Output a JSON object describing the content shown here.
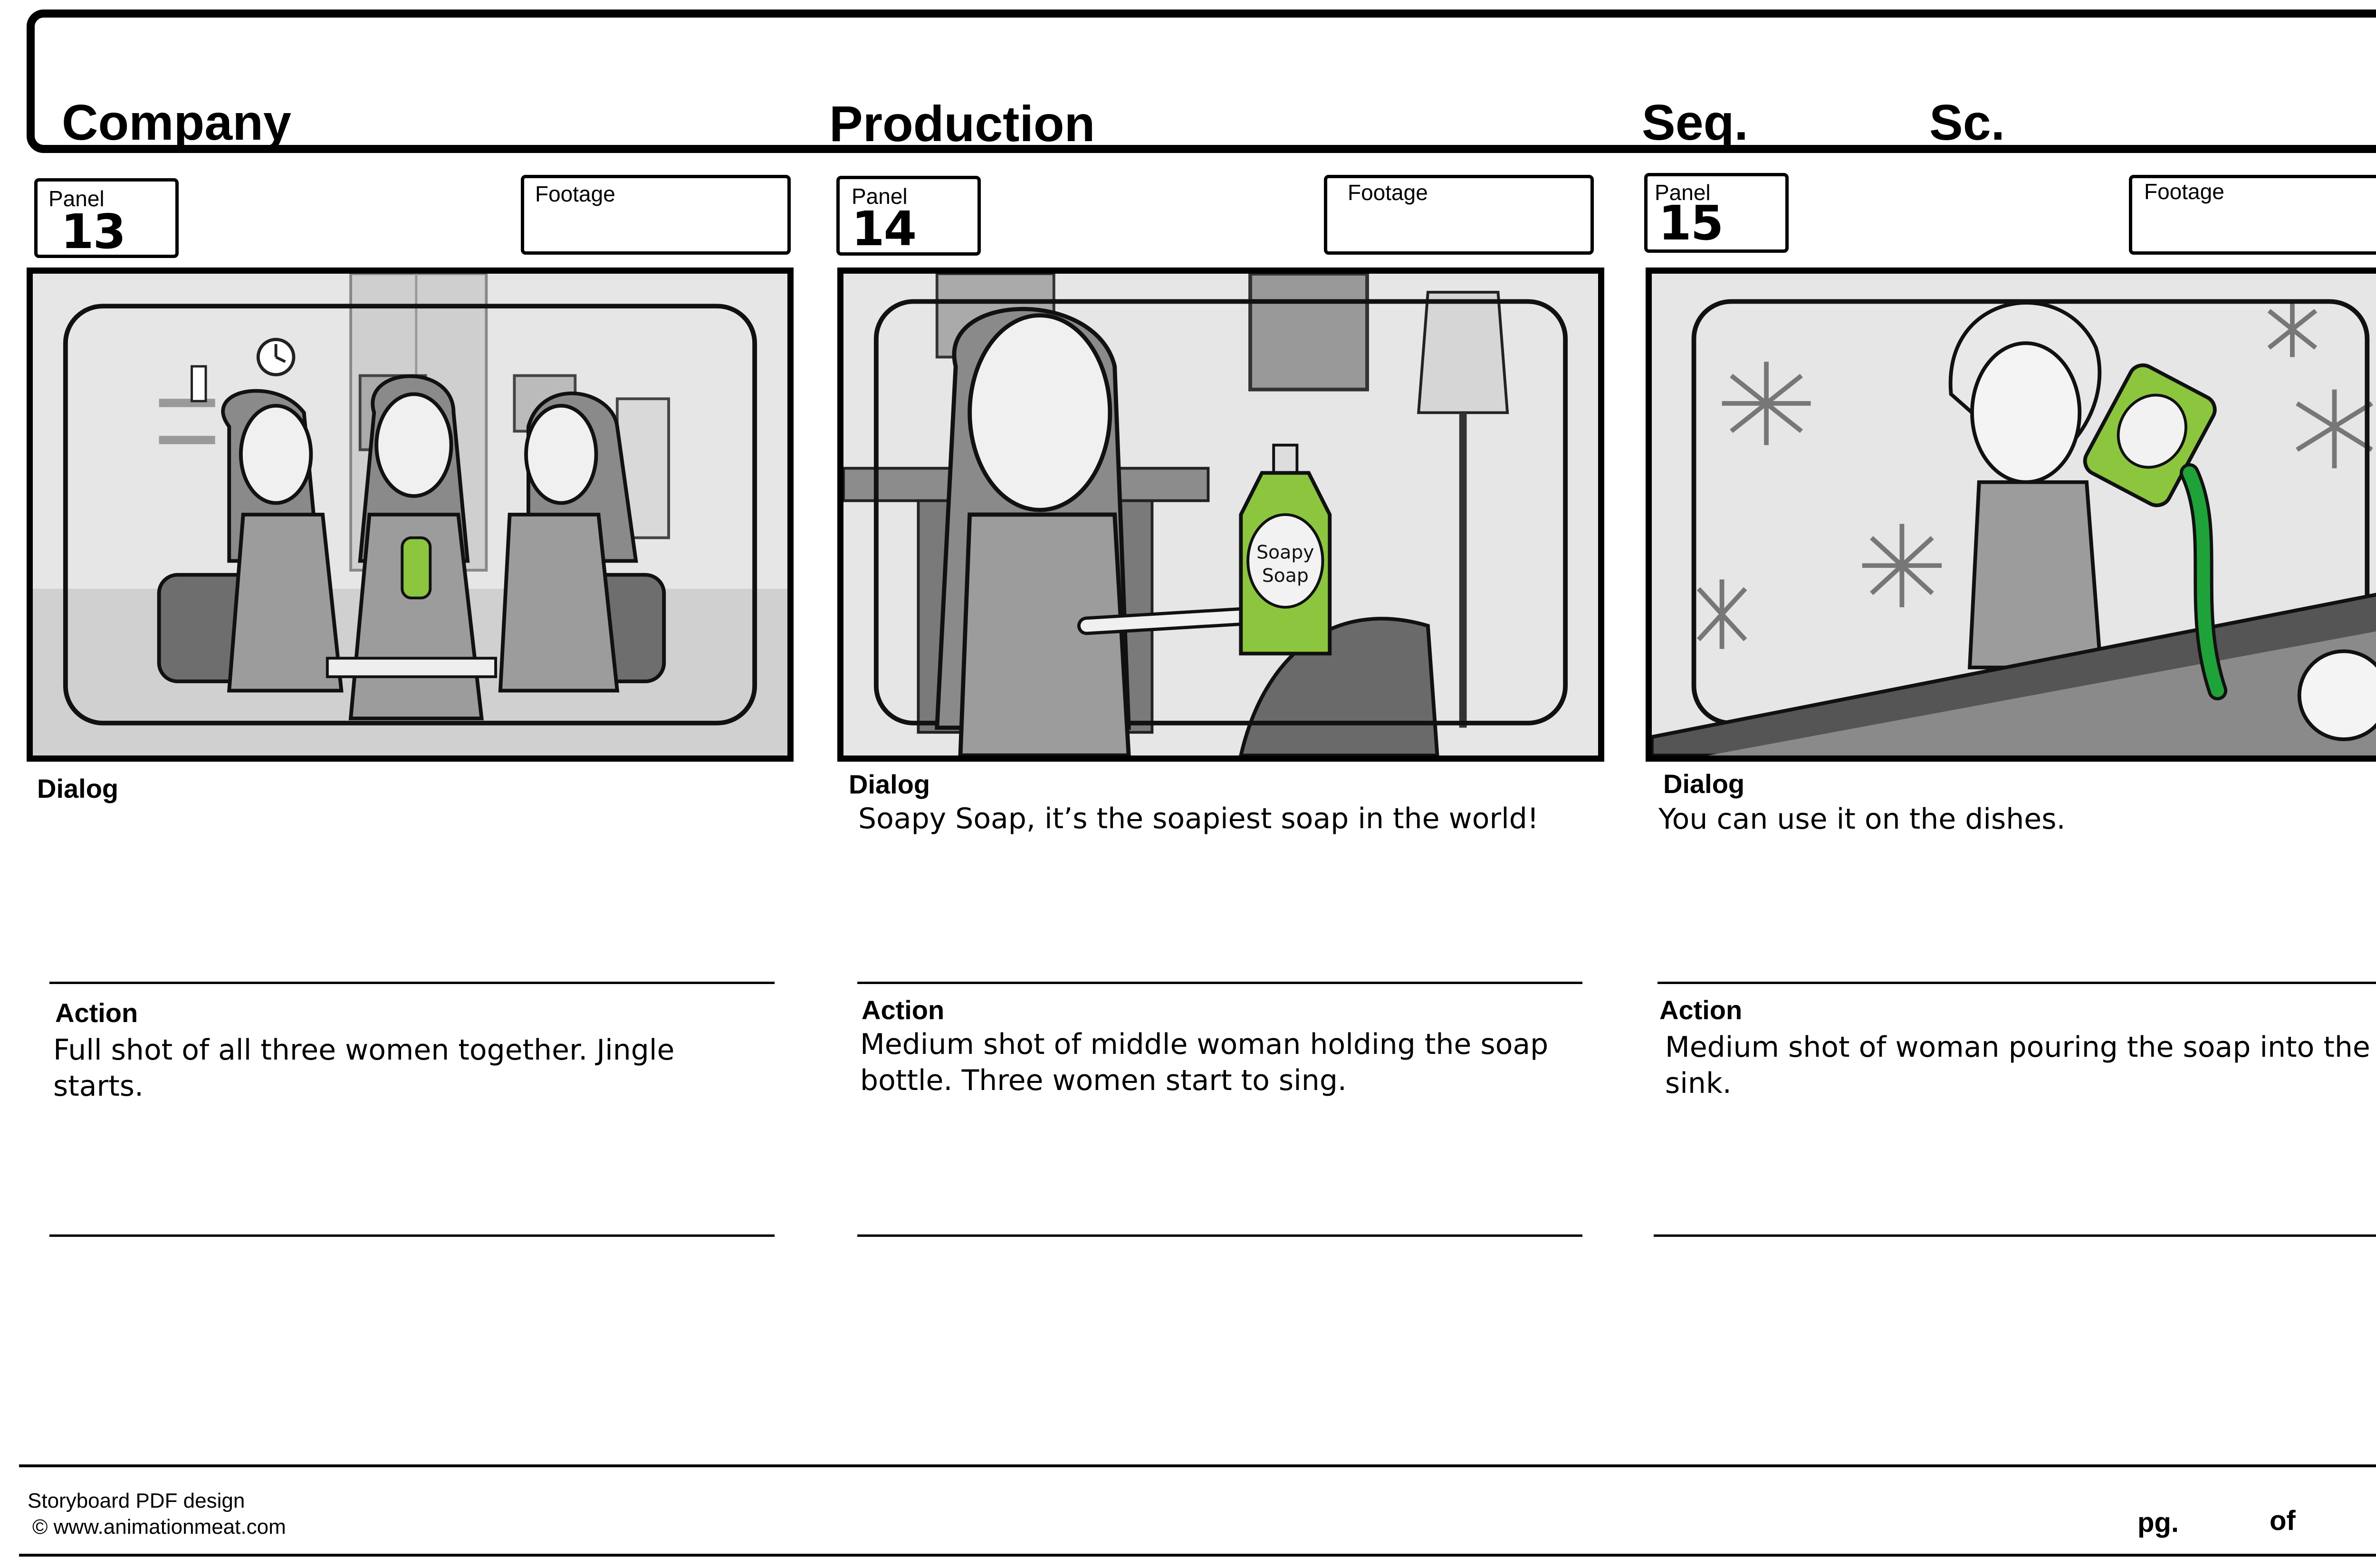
{
  "header": {
    "company_label": "Company",
    "production_label": "Production",
    "sequence_label": "Seq.",
    "scene_label": "Sc."
  },
  "panels": [
    {
      "panel_label": "Panel",
      "panel_number": "13",
      "footage_label": "Footage",
      "dialog_label": "Dialog",
      "dialog_text": "",
      "action_label": "Action",
      "action_text": "Full shot of all three women together. Jingle\nstarts."
    },
    {
      "panel_label": "Panel",
      "panel_number": "14",
      "footage_label": "Footage",
      "dialog_label": "Dialog",
      "dialog_text": "Soapy Soap, it’s the soapiest soap in the world!",
      "action_label": "Action",
      "action_text": "Medium shot of middle woman holding the soap\nbottle. Three women start to sing."
    },
    {
      "panel_label": "Panel",
      "panel_number": "15",
      "footage_label": "Footage",
      "dialog_label": "Dialog",
      "dialog_text": "You can use it on the dishes.",
      "action_label": "Action",
      "action_text": "Medium shot of woman pouring the soap into the\nsink."
    }
  ],
  "artwork": {
    "bottle_label_line1": "Soapy",
    "bottle_label_line2": "Soap",
    "bottle_color": "#8cc63f",
    "soap_pour_color": "#1fa23a",
    "background_gray": "#e6e6e6"
  },
  "footer": {
    "design_credit": "Storyboard PDF design",
    "copyright": "© www.animationmeat.com",
    "page_label": "pg.",
    "of_label": "of"
  }
}
